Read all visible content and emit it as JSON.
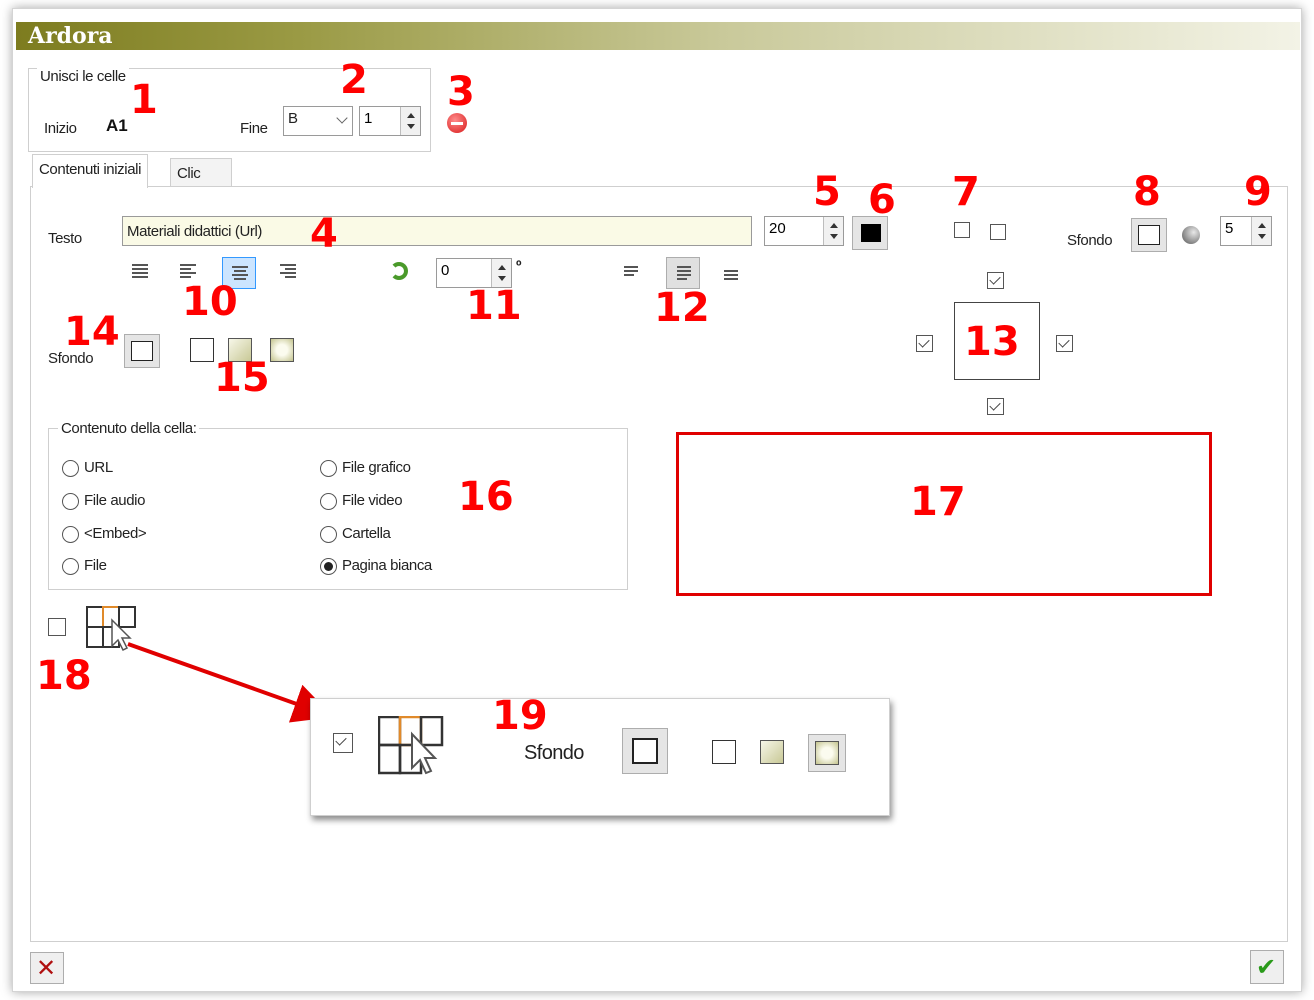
{
  "app": {
    "title": "Ardora"
  },
  "merge": {
    "group_label": "Unisci le celle",
    "start_label": "Inizio",
    "start_value": "A1",
    "end_label": "Fine",
    "end_column": "B",
    "end_row": "1"
  },
  "tabs": [
    {
      "label": "Contenuti iniziali",
      "active": true
    },
    {
      "label": "Clic",
      "active": false
    }
  ],
  "text": {
    "label": "Testo",
    "value": "Materiali didattici (Url)",
    "font_size": "20",
    "color": "#000000"
  },
  "rotation": {
    "value": "0",
    "unit": "º"
  },
  "background": {
    "label": "Sfondo",
    "opacity": "5"
  },
  "cell_background": {
    "label": "Sfondo"
  },
  "content": {
    "group_label": "Contenuto della cella:",
    "options_left": [
      "URL",
      "File audio",
      "<Embed>",
      "File"
    ],
    "options_right": [
      "File grafico",
      "File video",
      "Cartella",
      "Pagina bianca"
    ],
    "selected": "Pagina bianca"
  },
  "popup": {
    "label": "Sfondo",
    "checked": true
  },
  "annotations": [
    "1",
    "2",
    "3",
    "4",
    "5",
    "6",
    "7",
    "8",
    "9",
    "10",
    "11",
    "12",
    "13",
    "14",
    "15",
    "16",
    "17",
    "18",
    "19"
  ],
  "colors": {
    "accent_red": "#ff0000",
    "title_olive": "#7d7c1f",
    "text_bg": "#fafae6"
  }
}
